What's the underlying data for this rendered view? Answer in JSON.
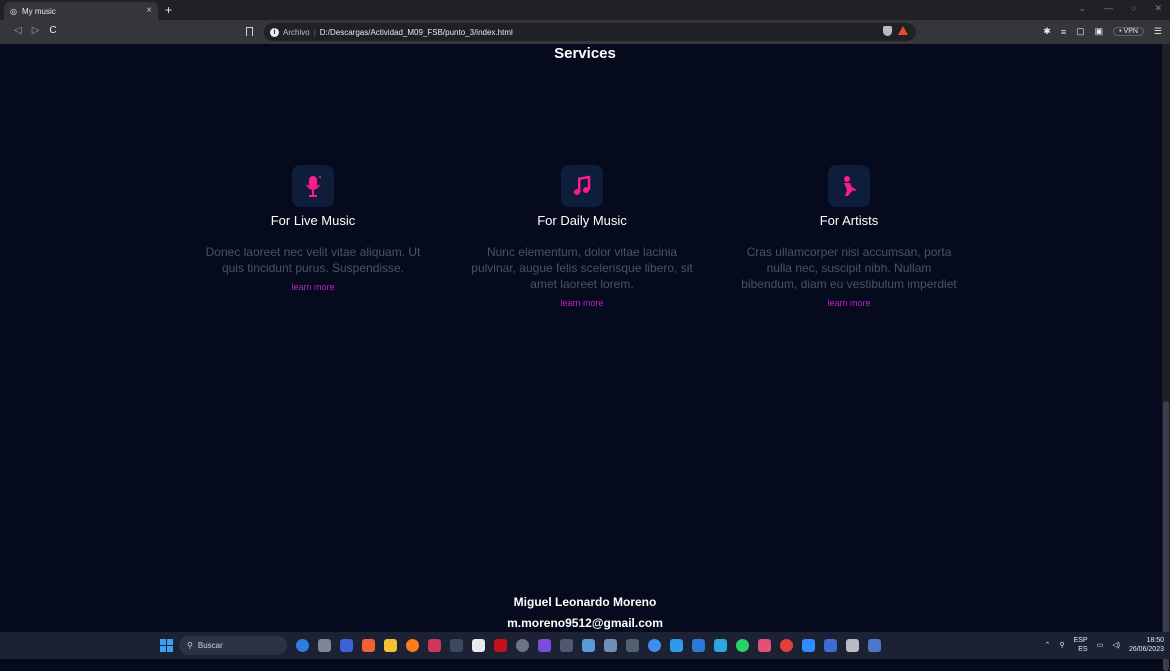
{
  "browser": {
    "tab_title": "My music",
    "tab_close": "×",
    "new_tab": "+",
    "address_scheme": "Archivo",
    "address_separator": "|",
    "address_url": "D:/Descargas/Actividad_M09_FSB/punto_3/index.html",
    "vpn_label": "• VPN"
  },
  "page": {
    "section_title": "Services",
    "services": [
      {
        "title": "For Live Music",
        "text": "Donec laoreet nec velit vitae aliquam. Ut quis tincidunt purus. Suspendisse.",
        "link": "learn more",
        "icon": "microphone-icon"
      },
      {
        "title": "For Daily Music",
        "text": "Nunc elementum, dolor vitae lacinia pulvinar, augue felis scelerisque libero, sit amet laoreet lorem.",
        "link": "learn more",
        "icon": "music-notes-icon"
      },
      {
        "title": "For Artists",
        "text": "Cras ullamcorper nisi accumsan, porta nulla nec, suscipit nibh. Nullam bibendum, diam eu vestibulum imperdiet",
        "link": "learn more",
        "icon": "guitar-icon"
      }
    ],
    "footer_name": "Miguel Leonardo Moreno",
    "footer_email": "m.moreno9512@gmail.com"
  },
  "taskbar": {
    "search_placeholder": "Buscar",
    "language": "ESP",
    "language_sub": "ES",
    "time": "18:50",
    "date": "26/06/2023"
  },
  "colors": {
    "background": "#050b1c",
    "accent": "#ff1a8c",
    "link": "#c51ec9",
    "icon_box": "#0d1d3a"
  }
}
